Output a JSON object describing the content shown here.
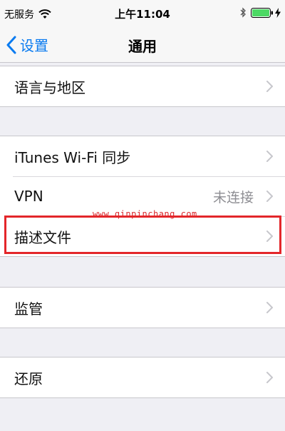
{
  "status_bar": {
    "carrier": "无服务",
    "time": "上午11:04"
  },
  "nav": {
    "back_label": "设置",
    "title": "通用"
  },
  "groups": [
    {
      "rows": [
        {
          "label": "语言与地区"
        }
      ]
    },
    {
      "rows": [
        {
          "label": "iTunes Wi-Fi 同步"
        },
        {
          "label": "VPN",
          "value": "未连接"
        },
        {
          "label": "描述文件"
        }
      ]
    },
    {
      "rows": [
        {
          "label": "监管"
        }
      ]
    },
    {
      "rows": [
        {
          "label": "还原"
        }
      ]
    }
  ],
  "watermark": "www.qinpinchang.com",
  "colors": {
    "accent": "#0a7bf0",
    "highlight_border": "#e3262a",
    "battery": "#4cd964",
    "background": "#efeff4"
  }
}
